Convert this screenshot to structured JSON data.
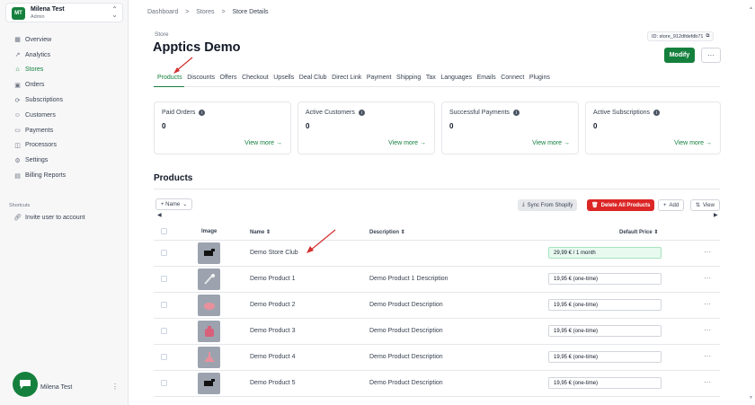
{
  "account": {
    "initials": "MT",
    "name": "Milena Test",
    "role": "Admin"
  },
  "sidebar": {
    "items": [
      {
        "label": "Overview",
        "icon": "grid-icon"
      },
      {
        "label": "Analytics",
        "icon": "chart-icon"
      },
      {
        "label": "Stores",
        "icon": "store-icon",
        "active": true
      },
      {
        "label": "Orders",
        "icon": "box-icon"
      },
      {
        "label": "Subscriptions",
        "icon": "repeat-icon"
      },
      {
        "label": "Customers",
        "icon": "users-icon"
      },
      {
        "label": "Payments",
        "icon": "card-icon"
      },
      {
        "label": "Processors",
        "icon": "cpu-icon"
      },
      {
        "label": "Settings",
        "icon": "gear-icon"
      },
      {
        "label": "Billing Reports",
        "icon": "file-icon"
      }
    ],
    "shortcuts_title": "Shortcuts",
    "shortcuts": [
      {
        "label": "Invite user to account",
        "icon": "link-icon"
      }
    ],
    "footer_user": "Milena Test"
  },
  "breadcrumb": [
    "Dashboard",
    ">",
    "Stores",
    ">",
    "Store Details"
  ],
  "header": {
    "label": "Store",
    "title": "Apptics Demo",
    "store_id": "ID: store_912dfdefdb71",
    "modify": "Modify"
  },
  "tabs": [
    "Products",
    "Discounts",
    "Offers",
    "Checkout",
    "Upsells",
    "Deal Club",
    "Direct Link",
    "Payment",
    "Shipping",
    "Tax",
    "Languages",
    "Emails",
    "Connect",
    "Plugins"
  ],
  "stats": [
    {
      "title": "Paid Orders",
      "value": "0",
      "link": "View more →"
    },
    {
      "title": "Active Customers",
      "value": "0",
      "link": "View more →"
    },
    {
      "title": "Successful Payments",
      "value": "0",
      "link": "View more →"
    },
    {
      "title": "Active Subscriptions",
      "value": "0",
      "link": "View more →"
    }
  ],
  "products": {
    "title": "Products",
    "filter": "+ Name",
    "sync": "Sync From Shopify",
    "delete_all": "Delete All Products",
    "add": "Add",
    "view": "View",
    "columns": [
      "Image",
      "Name",
      "Description",
      "Default Price"
    ],
    "rows": [
      {
        "name": "Demo Store Club",
        "description": "",
        "price": "29,99 € / 1 month"
      },
      {
        "name": "Demo Product 1",
        "description": "Demo Product 1 Description",
        "price": "19,95 € (one-time)"
      },
      {
        "name": "Demo Product 2",
        "description": "Demo Product Description",
        "price": "19,95 € (one-time)"
      },
      {
        "name": "Demo Product 3",
        "description": "Demo Product Description",
        "price": "19,95 € (one-time)"
      },
      {
        "name": "Demo Product 4",
        "description": "Demo Product Description",
        "price": "19,95 € (one-time)"
      },
      {
        "name": "Demo Product 5",
        "description": "Demo Product Description",
        "price": "19,95 € (one-time)"
      }
    ]
  },
  "colors": {
    "accent": "#15803d",
    "danger": "#dc2626",
    "annotation": "#d32f2f"
  }
}
